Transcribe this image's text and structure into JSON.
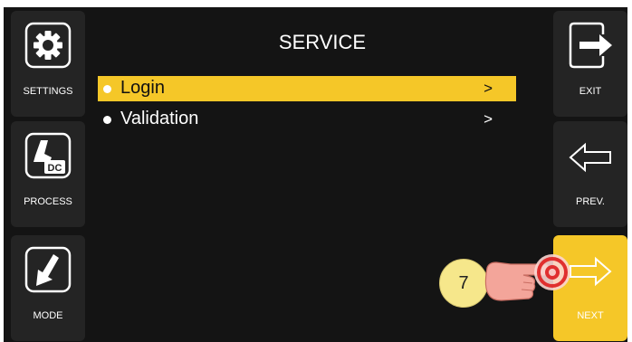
{
  "screen": {
    "title": "SERVICE"
  },
  "left_buttons": [
    {
      "label": "SETTINGS",
      "icon": "gear-icon"
    },
    {
      "label": "PROCESS",
      "icon": "dc-torch-icon",
      "icon_text": "DC"
    },
    {
      "label": "MODE",
      "icon": "mode-arrow-icon"
    }
  ],
  "right_buttons": [
    {
      "label": "EXIT",
      "icon": "exit-arrow-icon"
    },
    {
      "label": "PREV.",
      "icon": "left-arrow-icon"
    },
    {
      "label": "NEXT",
      "icon": "right-arrow-icon"
    }
  ],
  "menu": {
    "items": [
      {
        "label": "Login",
        "arrow": ">",
        "selected": true
      },
      {
        "label": "Validation",
        "arrow": ">",
        "selected": false
      }
    ]
  },
  "annotation": {
    "step_number": "7"
  },
  "colors": {
    "accent": "#f5c728",
    "background": "#141414",
    "button": "#242424",
    "text": "#ffffff"
  }
}
